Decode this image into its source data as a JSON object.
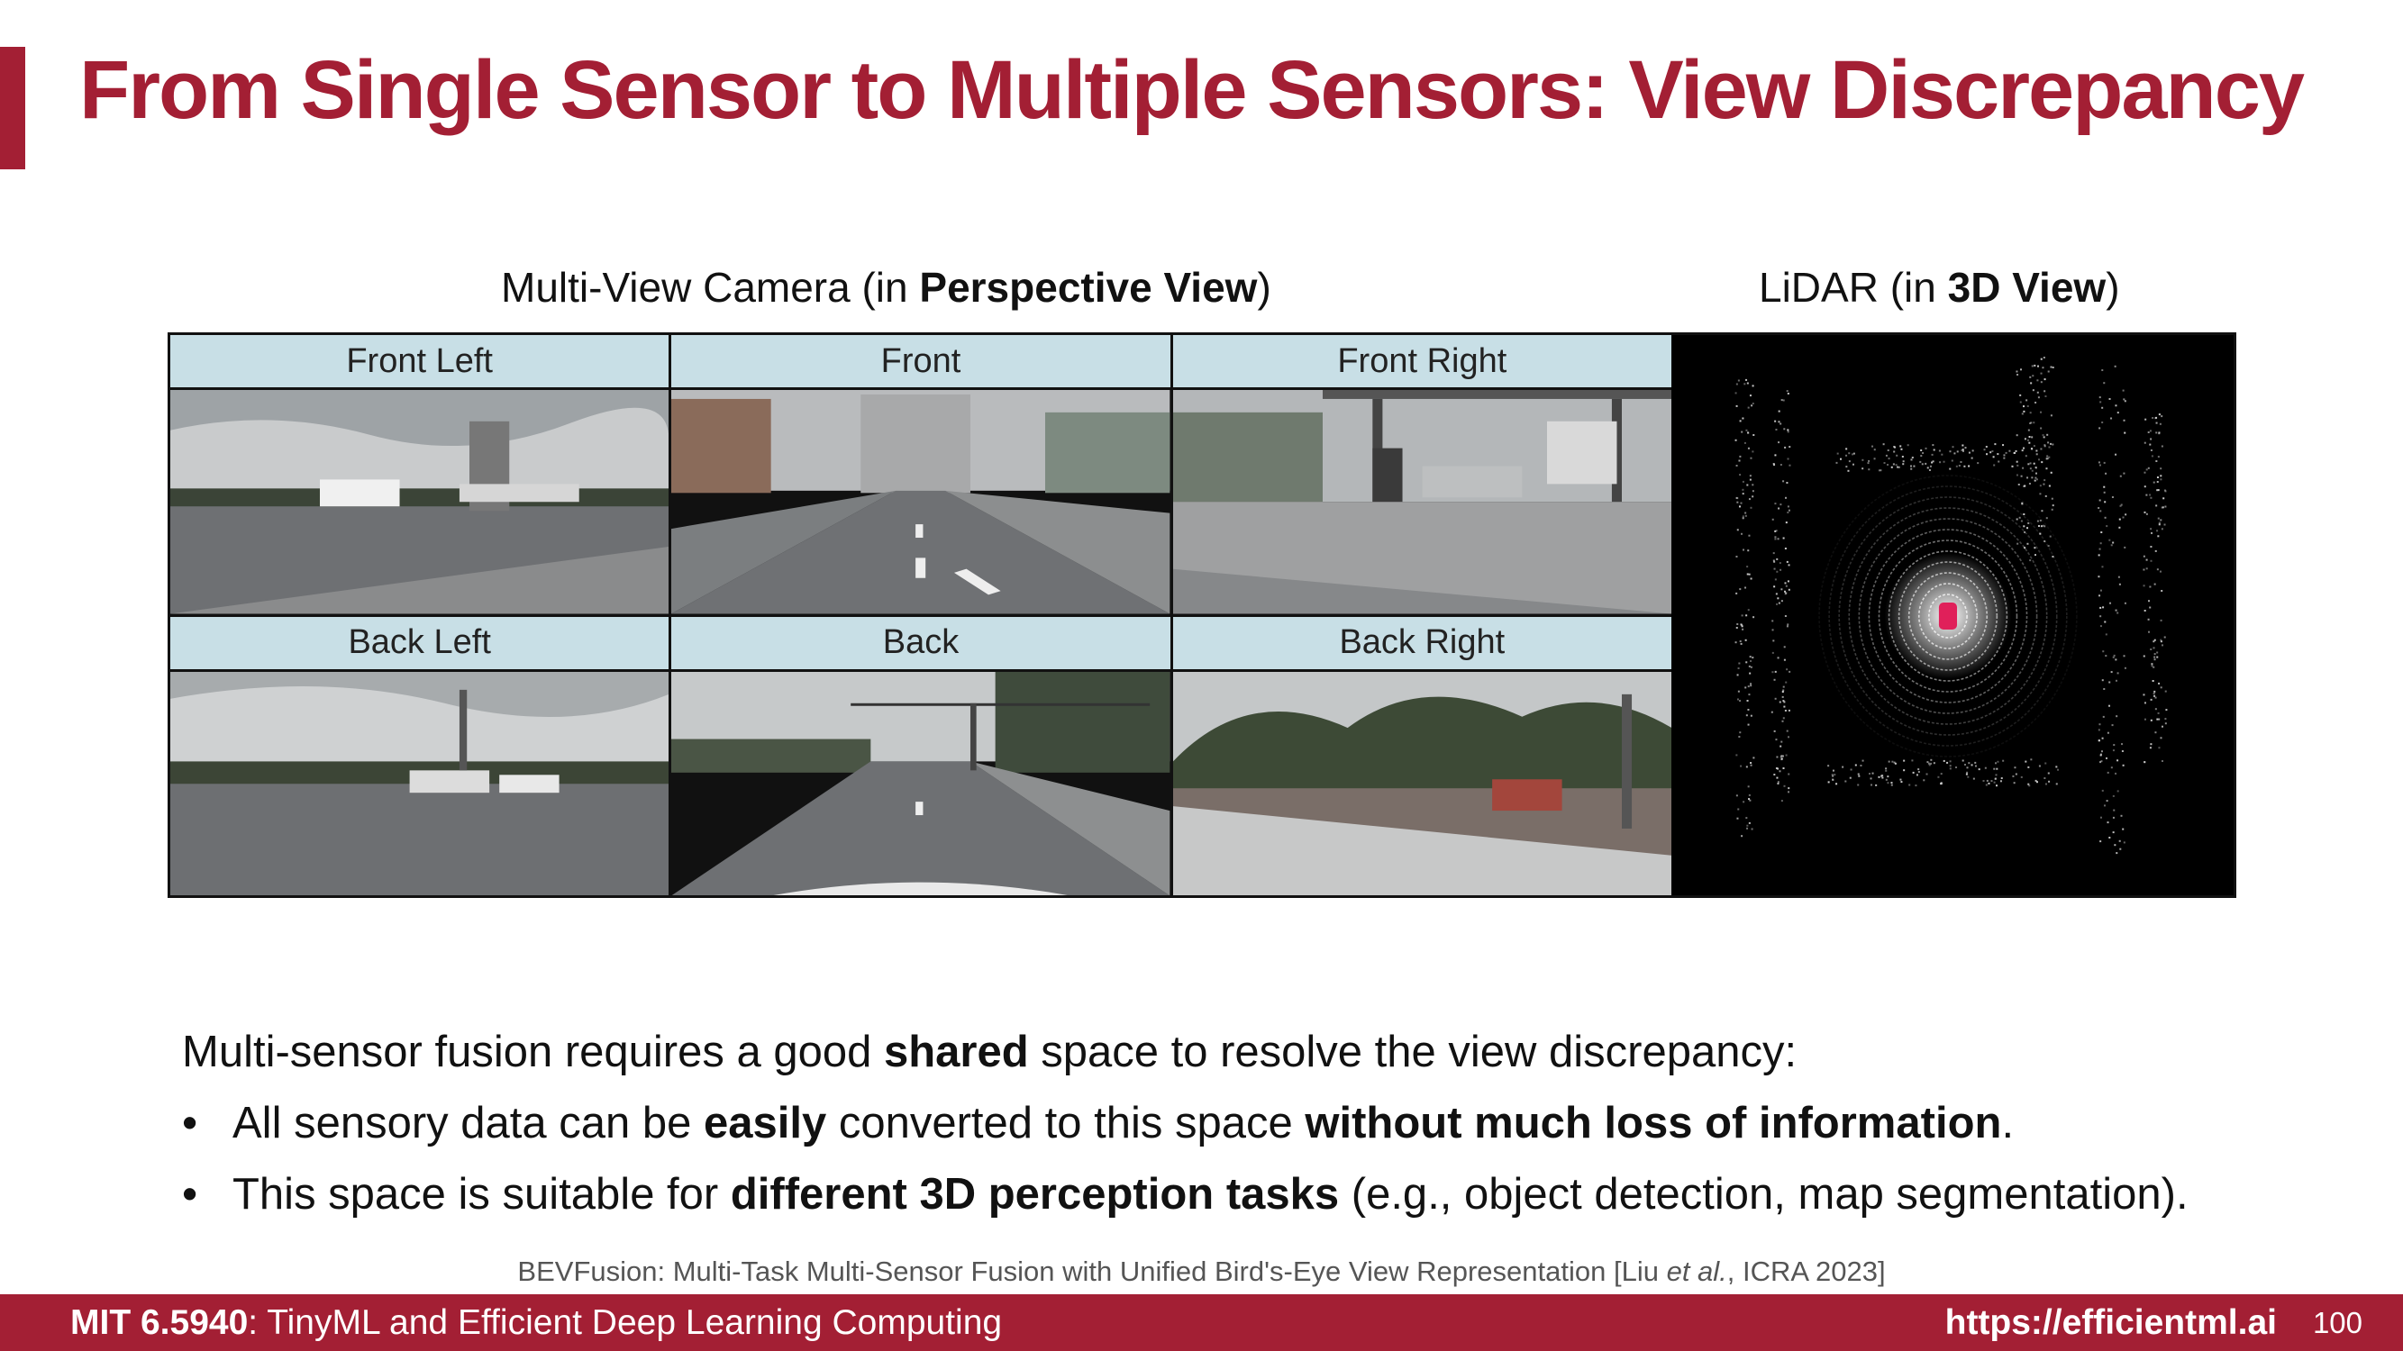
{
  "title": "From Single Sensor to Multiple Sensors: View Discrepancy",
  "camera_section": {
    "prefix": "Multi-View Camera (in ",
    "bold": "Perspective View",
    "suffix": ")"
  },
  "lidar_section": {
    "prefix": "LiDAR (in ",
    "bold": "3D View",
    "suffix": ")"
  },
  "camera_views": [
    "Front Left",
    "Front",
    "Front Right",
    "Back Left",
    "Back",
    "Back Right"
  ],
  "intro": {
    "prefix": "Multi-sensor fusion requires a good ",
    "bold": "shared",
    "suffix": " space to resolve the view discrepancy:"
  },
  "bullets": [
    {
      "marker": "•",
      "p1": "All sensory data can be ",
      "b1": "easily",
      "p2": " converted to this space ",
      "b2": "without much loss of information",
      "p3": "."
    },
    {
      "marker": "•",
      "p1": "This space is suitable for ",
      "b1": "different 3D perception tasks",
      "p2": " (e.g., object detection, map segmentation).",
      "b2": "",
      "p3": ""
    }
  ],
  "citation": {
    "prefix": "BEVFusion: Multi-Task Multi-Sensor Fusion with Unified Bird's-Eye View Representation [Liu ",
    "italic": "et al.",
    "suffix": ", ICRA 2023]"
  },
  "footer": {
    "course_code": "MIT 6.5940",
    "course_name": ": TinyML and Efficient Deep Learning Computing",
    "url": "https://efficientml.ai",
    "page_number": "100"
  },
  "colors": {
    "accent": "#a31f34",
    "label_bg": "#c8dfe6",
    "lidar_bg": "#000000",
    "ego_vehicle": "#e0205a"
  }
}
